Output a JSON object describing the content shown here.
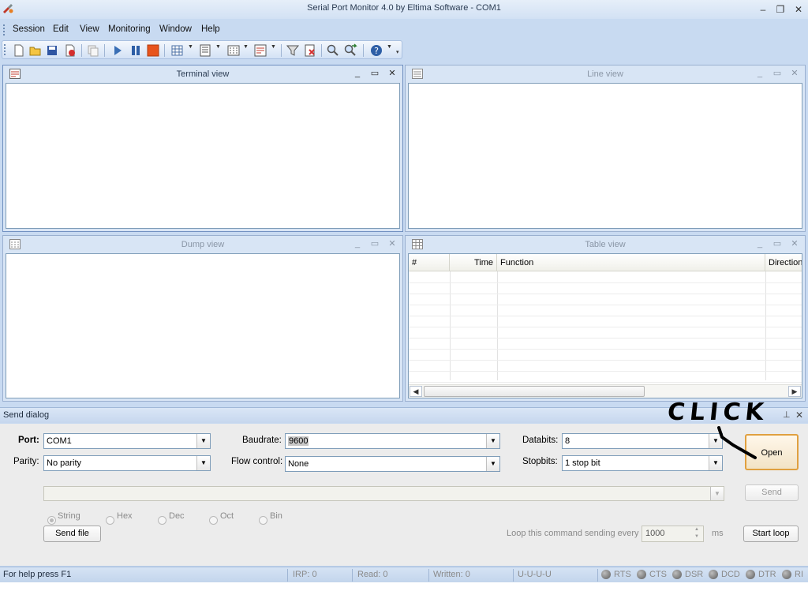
{
  "window": {
    "title": "Serial Port Monitor 4.0 by Eltima Software - COM1"
  },
  "menu": [
    {
      "label": "Session"
    },
    {
      "label": "Edit"
    },
    {
      "label": "View"
    },
    {
      "label": "Monitoring"
    },
    {
      "label": "Window"
    },
    {
      "label": "Help"
    }
  ],
  "toolbar": {
    "icons": [
      "new-session-icon",
      "open-icon",
      "save-icon",
      "close-session-icon",
      "copy-icon",
      "start-icon",
      "pause-icon",
      "stop-icon",
      "grid-icon",
      "view-list-icon",
      "dump-icon",
      "terminal-icon",
      "filter-icon",
      "clear-icon",
      "search-icon",
      "find-next-icon",
      "help-icon"
    ]
  },
  "panels": {
    "terminal": {
      "title": "Terminal view"
    },
    "line": {
      "title": "Line view"
    },
    "dump": {
      "title": "Dump view"
    },
    "table": {
      "title": "Table view",
      "columns": [
        "#",
        "Time",
        "Function",
        "Direction"
      ]
    }
  },
  "send_dialog": {
    "title": "Send dialog",
    "port_label": "Port:",
    "port_value": "COM1",
    "baudrate_label": "Baudrate:",
    "baudrate_value": "9600",
    "databits_label": "Databits:",
    "databits_value": "8",
    "parity_label": "Parity:",
    "parity_value": "No parity",
    "flow_label": "Flow control:",
    "flow_value": "None",
    "stopbits_label": "Stopbits:",
    "stopbits_value": "1 stop bit",
    "open_label": "Open",
    "send_label": "Send",
    "formats": [
      "String",
      "Hex",
      "Dec",
      "Oct",
      "Bin"
    ],
    "selected_format": "String",
    "send_file_label": "Send file",
    "loop_label": "Loop this command sending every",
    "loop_value": "1000",
    "loop_unit": "ms",
    "start_loop_label": "Start loop",
    "annotation": "CLICK"
  },
  "status": {
    "help": "For help press F1",
    "irp": "IRP: 0",
    "read": "Read: 0",
    "written": "Written: 0",
    "uuuu": "U-U-U-U",
    "signals": [
      "RTS",
      "CTS",
      "DSR",
      "DCD",
      "DTR",
      "RI"
    ]
  }
}
